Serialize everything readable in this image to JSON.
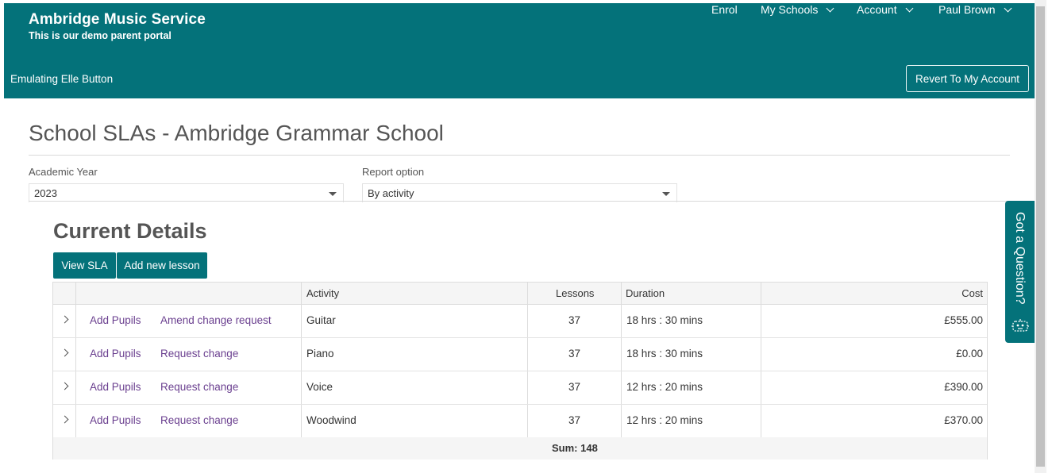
{
  "header": {
    "brand_title": "Ambridge Music Service",
    "brand_subtitle": "This is our demo parent portal",
    "nav": [
      {
        "label": "Enrol",
        "dropdown": false
      },
      {
        "label": "My Schools",
        "dropdown": true
      },
      {
        "label": "Account",
        "dropdown": true
      },
      {
        "label": "Paul Brown",
        "dropdown": true
      }
    ],
    "emulating_text": "Emulating Elle Button",
    "revert_label": "Revert To My Account"
  },
  "page": {
    "title": "School SLAs - Ambridge Grammar School"
  },
  "filters": {
    "year_label": "Academic Year",
    "year_value": "2023",
    "report_label": "Report option",
    "report_value": "By activity"
  },
  "section": {
    "title": "Current Details",
    "view_sla_label": "View SLA",
    "add_lesson_label": "Add new lesson"
  },
  "table": {
    "headers": {
      "activity": "Activity",
      "lessons": "Lessons",
      "duration": "Duration",
      "cost": "Cost"
    },
    "rows": [
      {
        "add_pupils": "Add Pupils",
        "change": "Amend change request",
        "activity": "Guitar",
        "lessons": "37",
        "duration": "18 hrs : 30 mins",
        "cost": "£555.00"
      },
      {
        "add_pupils": "Add Pupils",
        "change": "Request change",
        "activity": "Piano",
        "lessons": "37",
        "duration": "18 hrs : 30 mins",
        "cost": "£0.00"
      },
      {
        "add_pupils": "Add Pupils",
        "change": "Request change",
        "activity": "Voice",
        "lessons": "37",
        "duration": "12 hrs : 20 mins",
        "cost": "£390.00"
      },
      {
        "add_pupils": "Add Pupils",
        "change": "Request change",
        "activity": "Woodwind",
        "lessons": "37",
        "duration": "12 hrs : 20 mins",
        "cost": "£370.00"
      }
    ],
    "footer_sum": "Sum: 148"
  },
  "help_tab": {
    "label": "Got a Question?",
    "icon": "robot-icon"
  },
  "colors": {
    "brand": "#04727a",
    "link": "#6a3f8f"
  }
}
